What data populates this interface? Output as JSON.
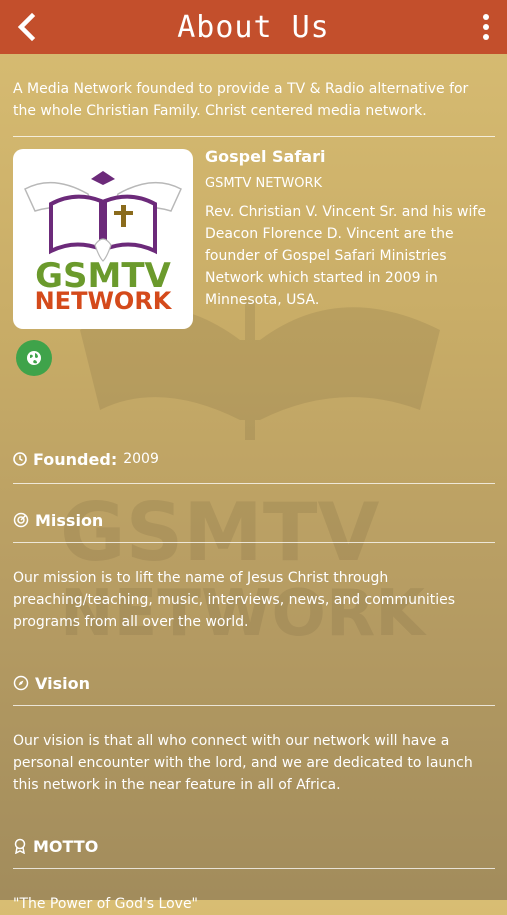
{
  "header": {
    "title": "About Us"
  },
  "intro": "A Media Network founded to provide a TV & Radio alternative for the whole Christian Family. Christ centered media network.",
  "organization": {
    "name": "Gospel Safari",
    "subtitle": "GSMTV NETWORK",
    "description": "Rev. Christian V. Vincent Sr. and his wife Deacon Florence D. Vincent are the founder of Gospel Safari Ministries Network which started in 2009 in Minnesota, USA.",
    "logo_text_top": "GSMTV",
    "logo_text_bottom": "NETWORK"
  },
  "founded": {
    "label": "Founded:",
    "value": "2009"
  },
  "mission": {
    "title": "Mission",
    "text": "Our mission is to lift the name of Jesus Christ through preaching/teaching, music, interviews, news, and communities programs from all over the world."
  },
  "vision": {
    "title": "Vision",
    "text": "Our vision is that all who connect with our network will have a personal encounter with the lord, and we are dedicated to launch this network in the near feature in all of Africa."
  },
  "motto": {
    "title": "MOTTO",
    "text": "\"The Power of God's Love\""
  },
  "colors": {
    "appbar": "#c34f2c",
    "web_button": "#3fa34a"
  },
  "icons": [
    "back-arrow-icon",
    "overflow-menu-icon",
    "globe-icon",
    "clock-icon",
    "target-icon",
    "compass-icon",
    "award-icon"
  ]
}
